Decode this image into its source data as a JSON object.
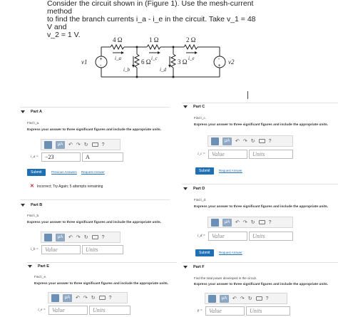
{
  "problem": {
    "line1": "Consider the circuit shown in (Figure 1). Use the mesh-current method",
    "line2": "to find the branch currents i_a - i_e in the circuit. Take v_1 = 48 V and",
    "line3": "v_2 = 1 V."
  },
  "circuit": {
    "r1": "4 Ω",
    "r2": "1 Ω",
    "r3": "2 Ω",
    "r4": "6 Ω",
    "r5": "3 Ω",
    "ia": "i_a",
    "ib": "i_b",
    "ic": "i_c",
    "id": "i_d",
    "ie": "i_e",
    "v1": "v1",
    "v2": "v2",
    "plus": "+",
    "minus": "-"
  },
  "toolbar": {
    "units_label": "μA",
    "help": "?"
  },
  "parts": {
    "a": {
      "title": "Part A",
      "find": "Find i_a.",
      "express": "Express your answer to three significant figures and include the appropriate units.",
      "label": "i_a =",
      "value": "−23",
      "units": "A",
      "submit": "Submit",
      "previous": "Previous Answers",
      "request": "Request Answer",
      "feedback": "Incorrect; Try Again; 5 attempts remaining"
    },
    "b": {
      "title": "Part B",
      "find": "Find i_b.",
      "express": "Express your answer to three significant figures and include the appropriate units.",
      "label": "i_b =",
      "value_placeholder": "Value",
      "units_placeholder": "Units"
    },
    "c": {
      "title": "Part C",
      "find": "Find i_c.",
      "express": "Express your answer to three significant figures and include the appropriate units.",
      "label": "i_c =",
      "value_placeholder": "Value",
      "units_placeholder": "Units",
      "submit": "Submit",
      "request": "Request Answer"
    },
    "d": {
      "title": "Part D",
      "find": "Find i_d.",
      "express": "Express your answer to three significant figures and include the appropriate units.",
      "label": "i_d =",
      "value_placeholder": "Value",
      "units_placeholder": "Units",
      "submit": "Submit",
      "request": "Request Answer"
    },
    "e": {
      "title": "Part E",
      "find": "Find i_e.",
      "express": "Express your answer to three significant figures and include the appropriate units.",
      "label": "i_e =",
      "value_placeholder": "Value",
      "units_placeholder": "Units"
    },
    "f": {
      "title": "Part F",
      "find": "Find the total power developed in the circuit.",
      "express": "Express your answer to three significant figures and include the appropriate units.",
      "label": "p =",
      "value_placeholder": "Value",
      "units_placeholder": "Units"
    }
  }
}
